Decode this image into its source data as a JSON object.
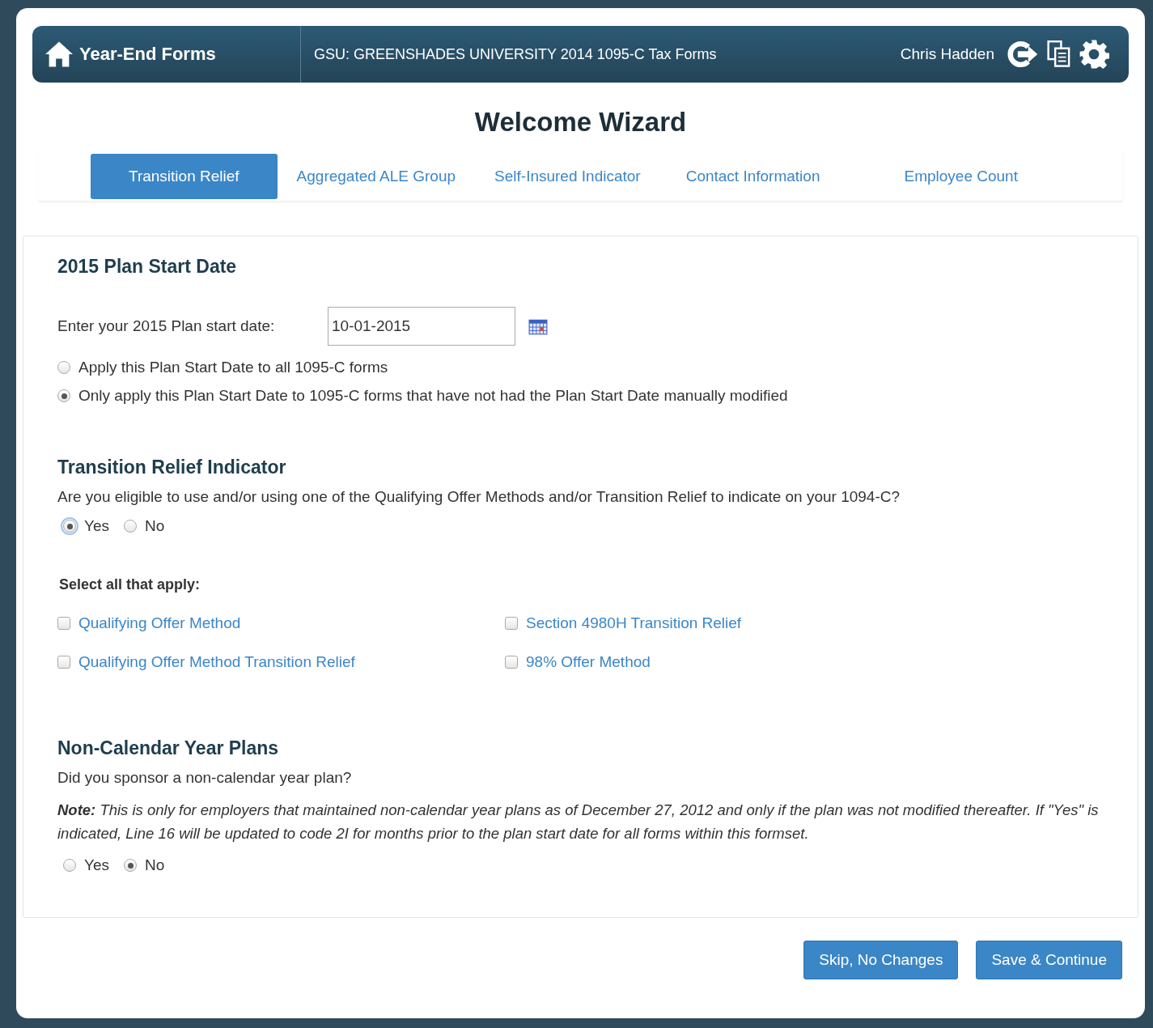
{
  "header": {
    "app_title": "Year-End Forms",
    "form_set": "GSU: GREENSHADES UNIVERSITY 2014 1095-C Tax Forms",
    "user": "Chris Hadden"
  },
  "wizard_title": "Welcome Wizard",
  "tabs": [
    {
      "label": "Transition Relief",
      "selected": true
    },
    {
      "label": "Aggregated ALE Group",
      "selected": false
    },
    {
      "label": "Self-Insured Indicator",
      "selected": false
    },
    {
      "label": "Contact Information",
      "selected": false
    },
    {
      "label": "Employee Count",
      "selected": false
    }
  ],
  "plan_start": {
    "heading": "2015 Plan Start Date",
    "label": "Enter your 2015 Plan start date:",
    "value": "10-01-2015",
    "options": [
      {
        "label": "Apply this Plan Start Date to all 1095-C forms",
        "selected": false
      },
      {
        "label": "Only apply this Plan Start Date to 1095-C forms that have not had the Plan Start Date manually modified",
        "selected": true
      }
    ]
  },
  "transition_relief": {
    "heading": "Transition Relief Indicator",
    "question": "Are you eligible to use and/or using one of the Qualifying Offer Methods and/or Transition Relief to indicate on your 1094-C?",
    "options": [
      {
        "label": "Yes",
        "selected": true
      },
      {
        "label": "No",
        "selected": false
      }
    ],
    "select_label": "Select all that apply:",
    "checkboxes": [
      {
        "label": "Qualifying Offer Method",
        "checked": false
      },
      {
        "label": "Section 4980H Transition Relief",
        "checked": false
      },
      {
        "label": "Qualifying Offer Method Transition Relief",
        "checked": false
      },
      {
        "label": "98% Offer Method",
        "checked": false
      }
    ]
  },
  "non_calendar": {
    "heading": "Non-Calendar Year Plans",
    "question": "Did you sponsor a non-calendar year plan?",
    "note": "**Note:** This is only for employers that maintained non-calendar year plans as of December 27, 2012 and only if the plan was not modified thereafter. If \"Yes\" is indicated, Line 16 will be updated to code 2I for months prior to the plan start date for all forms within this formset.",
    "options": [
      {
        "label": "Yes",
        "selected": false
      },
      {
        "label": "No",
        "selected": true
      }
    ]
  },
  "buttons": [
    "Skip, No Changes",
    "Save & Continue"
  ]
}
